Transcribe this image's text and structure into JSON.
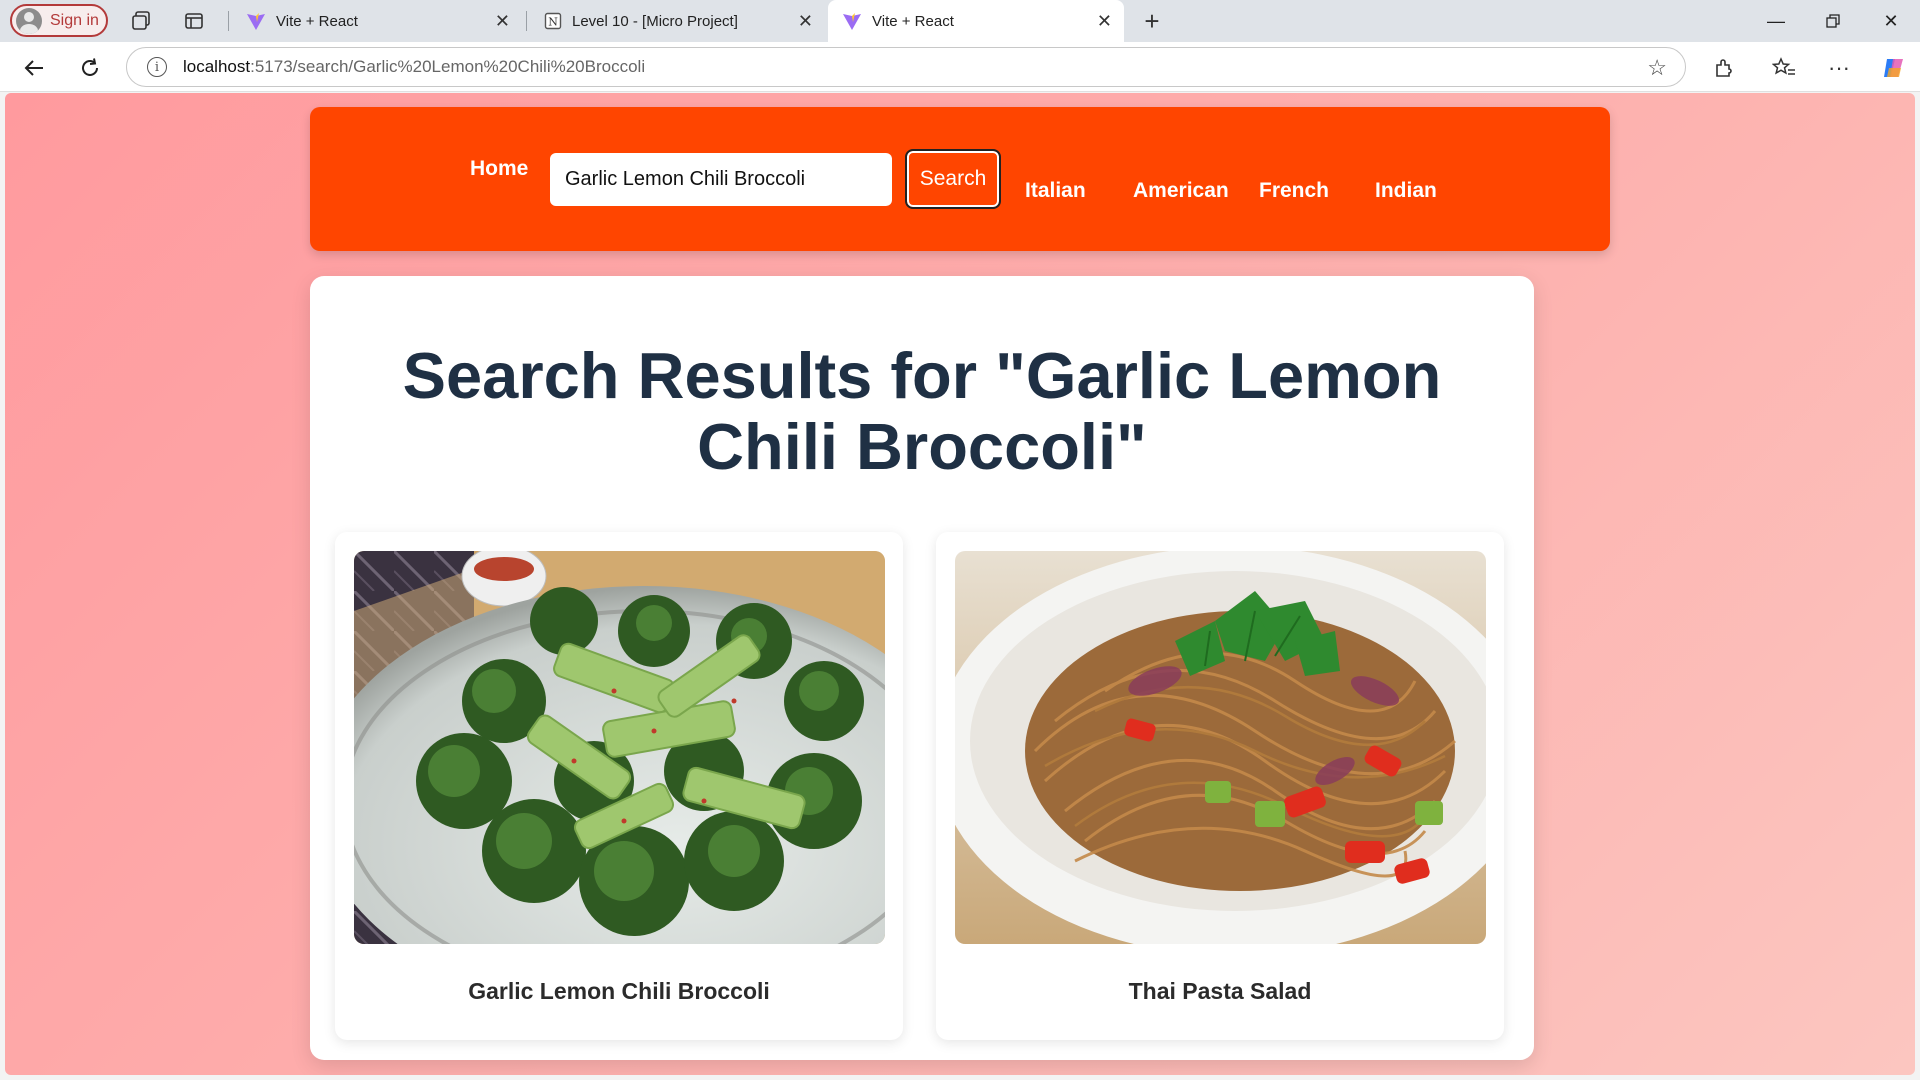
{
  "browser": {
    "signin_label": "Sign in",
    "tabs": [
      {
        "title": "Vite + React",
        "active": false
      },
      {
        "title": "Level 10 - [Micro Project]",
        "active": false
      },
      {
        "title": "Vite + React",
        "active": true
      }
    ],
    "url_host": "localhost",
    "url_path": ":5173/search/Garlic%20Lemon%20Chili%20Broccoli"
  },
  "navbar": {
    "home_label": "Home",
    "search_value": "Garlic Lemon Chili Broccoli",
    "search_button_label": "Search",
    "links": [
      "Italian",
      "American",
      "French",
      "Indian"
    ]
  },
  "results": {
    "title": "Search Results for \"Garlic Lemon Chili Broccoli\"",
    "recipes": [
      {
        "name": "Garlic Lemon Chili Broccoli",
        "image": "broccoli-dish"
      },
      {
        "name": "Thai Pasta Salad",
        "image": "pasta-salad-dish"
      }
    ]
  },
  "colors": {
    "navbar": "#ff4500",
    "title": "#1f3044",
    "background_start": "#ff9a9e",
    "background_end": "#fcc6c0"
  }
}
